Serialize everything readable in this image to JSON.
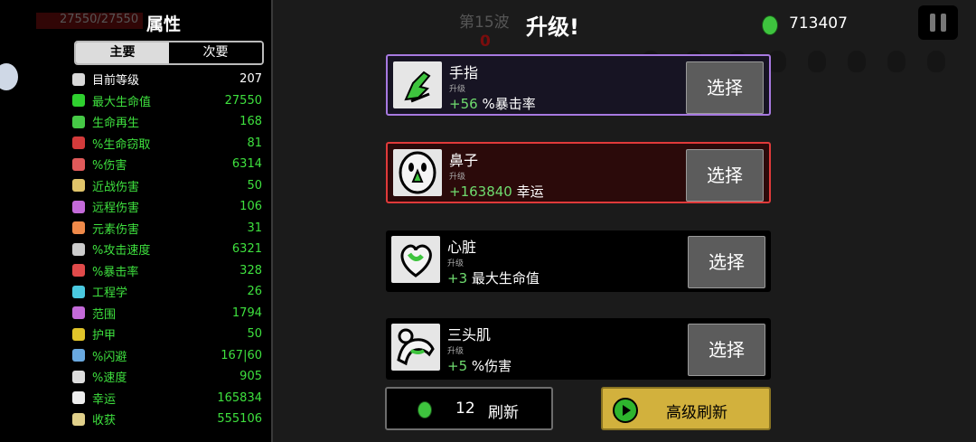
{
  "stats_panel": {
    "hp_text": "27550/27550",
    "title": "属性",
    "tabs": [
      {
        "label": "主要"
      },
      {
        "label": "次要"
      }
    ],
    "stats": [
      {
        "label": "目前等级",
        "value": "207",
        "color": "#ffffff",
        "icon_color": "#d9d9d9",
        "icon": "level-icon"
      },
      {
        "label": "最大生命值",
        "value": "27550",
        "color": "#3ee03e",
        "icon_color": "#2fd02f",
        "icon": "heart-icon"
      },
      {
        "label": "生命再生",
        "value": "168",
        "color": "#3ee03e",
        "icon_color": "#46c946",
        "icon": "regen-icon"
      },
      {
        "label": "%生命窃取",
        "value": "81",
        "color": "#3ee03e",
        "icon_color": "#d33b3b",
        "icon": "lifesteal-icon"
      },
      {
        "label": "%伤害",
        "value": "6314",
        "color": "#3ee03e",
        "icon_color": "#e05a5a",
        "icon": "damage-icon"
      },
      {
        "label": "近战伤害",
        "value": "50",
        "color": "#3ee03e",
        "icon_color": "#e0c46a",
        "icon": "sword-icon"
      },
      {
        "label": "远程伤害",
        "value": "106",
        "color": "#3ee03e",
        "icon_color": "#c46ad9",
        "icon": "ranged-icon"
      },
      {
        "label": "元素伤害",
        "value": "31",
        "color": "#3ee03e",
        "icon_color": "#f08a4a",
        "icon": "flame-icon"
      },
      {
        "label": "%攻击速度",
        "value": "6321",
        "color": "#3ee03e",
        "icon_color": "#cccccc",
        "icon": "hourglass-icon"
      },
      {
        "label": "%暴击率",
        "value": "328",
        "color": "#3ee03e",
        "icon_color": "#e04a4a",
        "icon": "crit-icon"
      },
      {
        "label": "工程学",
        "value": "26",
        "color": "#3ee03e",
        "icon_color": "#4ac9e0",
        "icon": "wrench-icon"
      },
      {
        "label": "范围",
        "value": "1794",
        "color": "#3ee03e",
        "icon_color": "#c46ad9",
        "icon": "range-icon"
      },
      {
        "label": "护甲",
        "value": "50",
        "color": "#3ee03e",
        "icon_color": "#e0c42a",
        "icon": "shield-icon"
      },
      {
        "label": "%闪避",
        "value": "167|60",
        "color": "#3ee03e",
        "icon_color": "#6aa9e0",
        "icon": "dodge-icon"
      },
      {
        "label": "%速度",
        "value": "905",
        "color": "#3ee03e",
        "icon_color": "#dddddd",
        "icon": "speed-icon"
      },
      {
        "label": "幸运",
        "value": "165834",
        "color": "#3ee03e",
        "icon_color": "#eeeeee",
        "icon": "dice-icon"
      },
      {
        "label": "收获",
        "value": "555106",
        "color": "#3ee03e",
        "icon_color": "#e0d08a",
        "icon": "harvest-icon"
      }
    ]
  },
  "header": {
    "wave": "第15波",
    "wave_counter": "0",
    "title": "升级!",
    "currency": "713407",
    "currency_icon": "material-icon",
    "pause_icon": "pause-icon"
  },
  "upgrades": [
    {
      "name": "手指",
      "subtitle": "升级",
      "bonus": "+56",
      "stat": "%暴击率",
      "icon": "finger-icon",
      "select_label": "选择"
    },
    {
      "name": "鼻子",
      "subtitle": "升级",
      "bonus": "+163840",
      "stat": "幸运",
      "icon": "nose-icon",
      "select_label": "选择"
    },
    {
      "name": "心脏",
      "subtitle": "升级",
      "bonus": "+3",
      "stat": "最大生命值",
      "icon": "heart-organ-icon",
      "select_label": "选择"
    },
    {
      "name": "三头肌",
      "subtitle": "升级",
      "bonus": "+5",
      "stat": "%伤害",
      "icon": "arm-icon",
      "select_label": "选择"
    }
  ],
  "footer": {
    "reroll_cost": "12",
    "reroll_label": "刷新",
    "advanced_reroll_label": "高级刷新"
  },
  "colors": {
    "accent_green": "#3ee03e",
    "rare_border": "#a779e0",
    "legendary_border": "#e03a3a",
    "gold_button": "#d2b13d"
  }
}
